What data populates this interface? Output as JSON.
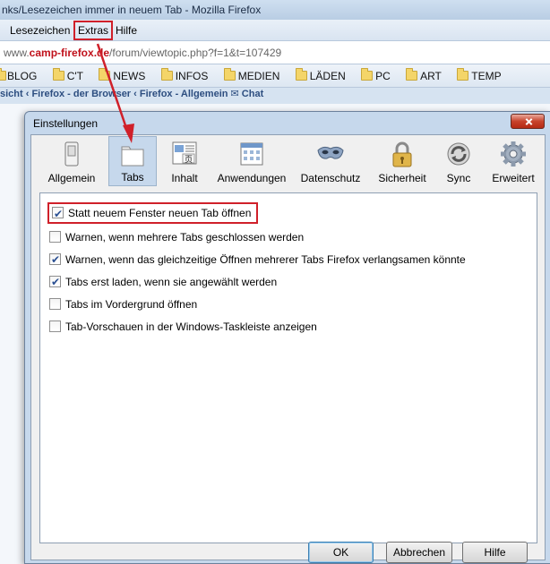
{
  "firefox": {
    "title": "nks/Lesezeichen immer in neuem Tab - Mozilla Firefox",
    "menus": [
      "Lesezeichen",
      "Extras",
      "Hilfe"
    ],
    "url_prefix": "www.",
    "url_domain": "camp-firefox.de",
    "url_rest": "/forum/viewtopic.php?f=1&t=107429",
    "bookmarks": [
      "BLOG",
      "C'T",
      "NEWS",
      "INFOS",
      "MEDIEN",
      "LÄDEN",
      "PC",
      "ART",
      "TEMP"
    ],
    "breadcrumb": "sicht ‹ Firefox - der Browser ‹ Firefox - Allgemein ✉ Chat"
  },
  "dialog": {
    "title": "Einstellungen",
    "panes": [
      {
        "label": "Allgemein",
        "icon": "switch-icon"
      },
      {
        "label": "Tabs",
        "icon": "tabs-icon"
      },
      {
        "label": "Inhalt",
        "icon": "content-icon"
      },
      {
        "label": "Anwendungen",
        "icon": "applications-icon"
      },
      {
        "label": "Datenschutz",
        "icon": "mask-icon"
      },
      {
        "label": "Sicherheit",
        "icon": "lock-icon"
      },
      {
        "label": "Sync",
        "icon": "sync-icon"
      },
      {
        "label": "Erweitert",
        "icon": "gear-icon"
      }
    ],
    "active_pane": "Tabs",
    "options": [
      {
        "label": "Statt neuem Fenster neuen Tab öffnen",
        "checked": true
      },
      {
        "label": "Warnen, wenn mehrere Tabs geschlossen werden",
        "checked": false
      },
      {
        "label": "Warnen, wenn das gleichzeitige Öffnen mehrerer Tabs Firefox verlangsamen könnte",
        "checked": true
      },
      {
        "label": "Tabs erst laden, wenn sie angewählt werden",
        "checked": true
      },
      {
        "label": "Tabs im Vordergrund öffnen",
        "checked": false
      },
      {
        "label": "Tab-Vorschauen in der Windows-Taskleiste anzeigen",
        "checked": false
      }
    ],
    "buttons": {
      "ok": "OK",
      "cancel": "Abbrechen",
      "help": "Hilfe"
    }
  },
  "colors": {
    "annotation": "#d0202a",
    "active_pane": "#c6d8ec"
  }
}
